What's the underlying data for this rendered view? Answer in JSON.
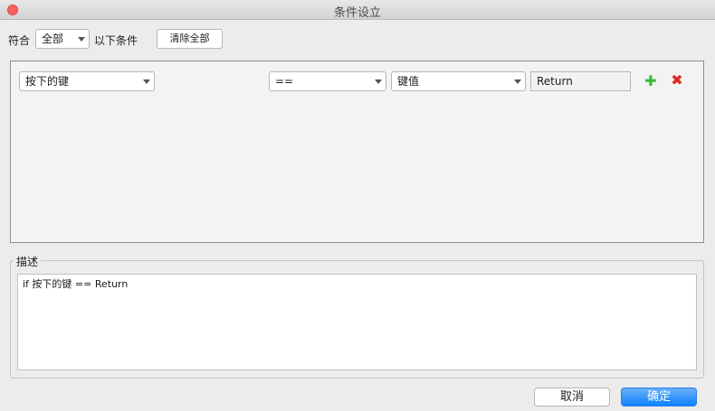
{
  "window": {
    "title": "条件设立"
  },
  "toolbar": {
    "match_label": "符合",
    "match_select_value": "全部",
    "suffix_label": "以下条件",
    "clear_all_label": "清除全部"
  },
  "conditions": [
    {
      "field": "按下的键",
      "operator": "==",
      "value_type": "键值",
      "value": "Return",
      "add_icon": "plus-icon",
      "delete_icon": "x-icon"
    }
  ],
  "description": {
    "label": "描述",
    "text": "if 按下的键 == Return"
  },
  "footer": {
    "cancel_label": "取消",
    "ok_label": "确定"
  },
  "colors": {
    "accent": "#0d81ff",
    "add": "#3db83d",
    "delete": "#e0281e",
    "close": "#fc605c"
  }
}
